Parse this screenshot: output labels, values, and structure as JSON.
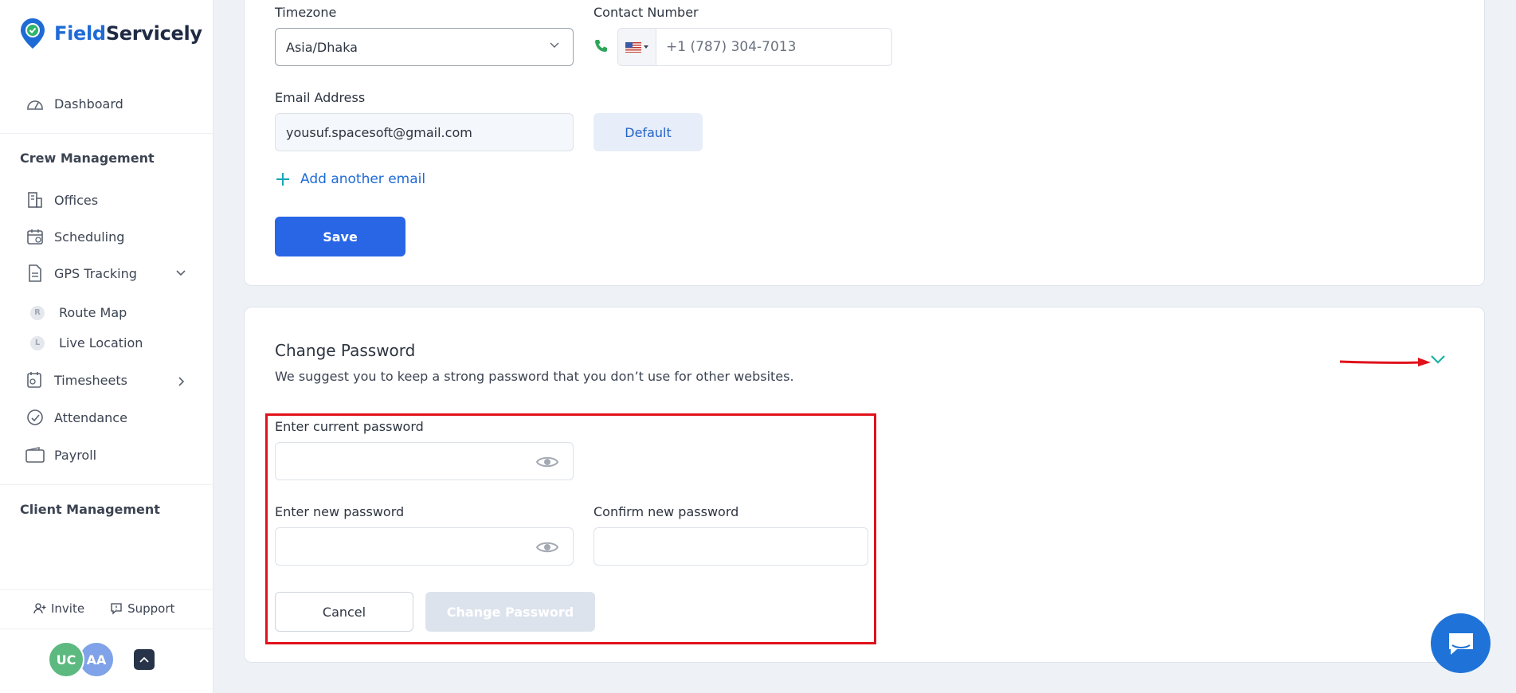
{
  "brand": {
    "name_part1": "Field",
    "name_part2": "Servicely"
  },
  "sidebar": {
    "dashboard": "Dashboard",
    "crew_section": "Crew Management",
    "items": {
      "offices": "Offices",
      "scheduling": "Scheduling",
      "gps": "GPS Tracking",
      "route_map": "Route Map",
      "route_map_badge": "R",
      "live_location": "Live Location",
      "live_location_badge": "L",
      "timesheets": "Timesheets",
      "attendance": "Attendance",
      "payroll": "Payroll"
    },
    "client_section": "Client Management",
    "footer": {
      "invite": "Invite",
      "support": "Support"
    },
    "avatars": [
      "UC",
      "AA"
    ]
  },
  "profile": {
    "timezone_label": "Timezone",
    "timezone_value": "Asia/Dhaka",
    "contact_label": "Contact Number",
    "phone_value": "+1 (787) 304-7013",
    "email_label": "Email Address",
    "email_value": "yousuf.spacesoft@gmail.com",
    "default_label": "Default",
    "add_email": "Add another email",
    "save": "Save"
  },
  "password": {
    "title": "Change Password",
    "description": "We suggest you to keep a strong password that you don’t use for other websites.",
    "current_label": "Enter current password",
    "new_label": "Enter new password",
    "confirm_label": "Confirm new password",
    "cancel": "Cancel",
    "submit": "Change Password"
  },
  "colors": {
    "accent": "#2866e6",
    "annotation": "#e0111a",
    "teal": "#17b3a3"
  }
}
